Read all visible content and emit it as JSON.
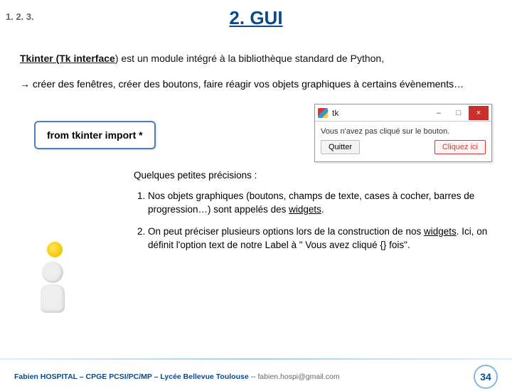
{
  "breadcrumb": "1. 2. 3.",
  "title": "2. GUI",
  "intro": {
    "tkinter": "Tkinter (Tk interface",
    "rest": ") est un module intégré à la bibliothèque standard de Python,"
  },
  "bullet": {
    "arrow": "→",
    "text": " créer des fenêtres, créer des boutons, faire réagir vos objets graphiques à certains évènements…"
  },
  "code": "from tkinter import *",
  "tk_window": {
    "title": "tk",
    "minimize": "–",
    "maximize": "□",
    "close": "×",
    "message": "Vous n'avez pas cliqué sur le bouton.",
    "quit": "Quitter",
    "click": "Cliquez ici"
  },
  "precisions": {
    "lead": "Quelques petites précisions :",
    "item1_pre": "Nos objets graphiques (boutons, champs de texte, cases à cocher, barres de progression…) sont appelés des ",
    "item1_widgets": "widgets",
    "item1_post": ".",
    "item2_pre": "On peut préciser plusieurs options lors de la construction de nos ",
    "item2_widgets": "widgets",
    "item2_post": ". Ici, on définit l'option text de notre Label à \" Vous avez cliqué {} fois\"."
  },
  "footer": {
    "author": "Fabien HOSPITAL – CPGE PCSI/PC/MP – Lycée Bellevue  Toulouse ",
    "sep": "-- ",
    "email": "fabien.hospi@gmail.com"
  },
  "page": "34"
}
